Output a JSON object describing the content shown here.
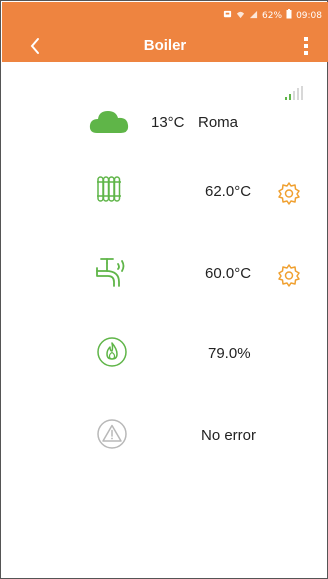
{
  "status_bar": {
    "battery": "62%",
    "time": "09:08"
  },
  "app_bar": {
    "title": "Boiler"
  },
  "weather": {
    "temperature": "13°C",
    "city": "Roma"
  },
  "heating": {
    "value": "62.0°C"
  },
  "hot_water": {
    "value": "60.0°C"
  },
  "modulation": {
    "value": "79.0%"
  },
  "error": {
    "value": "No error"
  },
  "colors": {
    "accent": "#ee8440",
    "icon_green": "#5fb548",
    "gear_orange": "#f0a030",
    "error_gray": "#b8b8b8"
  }
}
